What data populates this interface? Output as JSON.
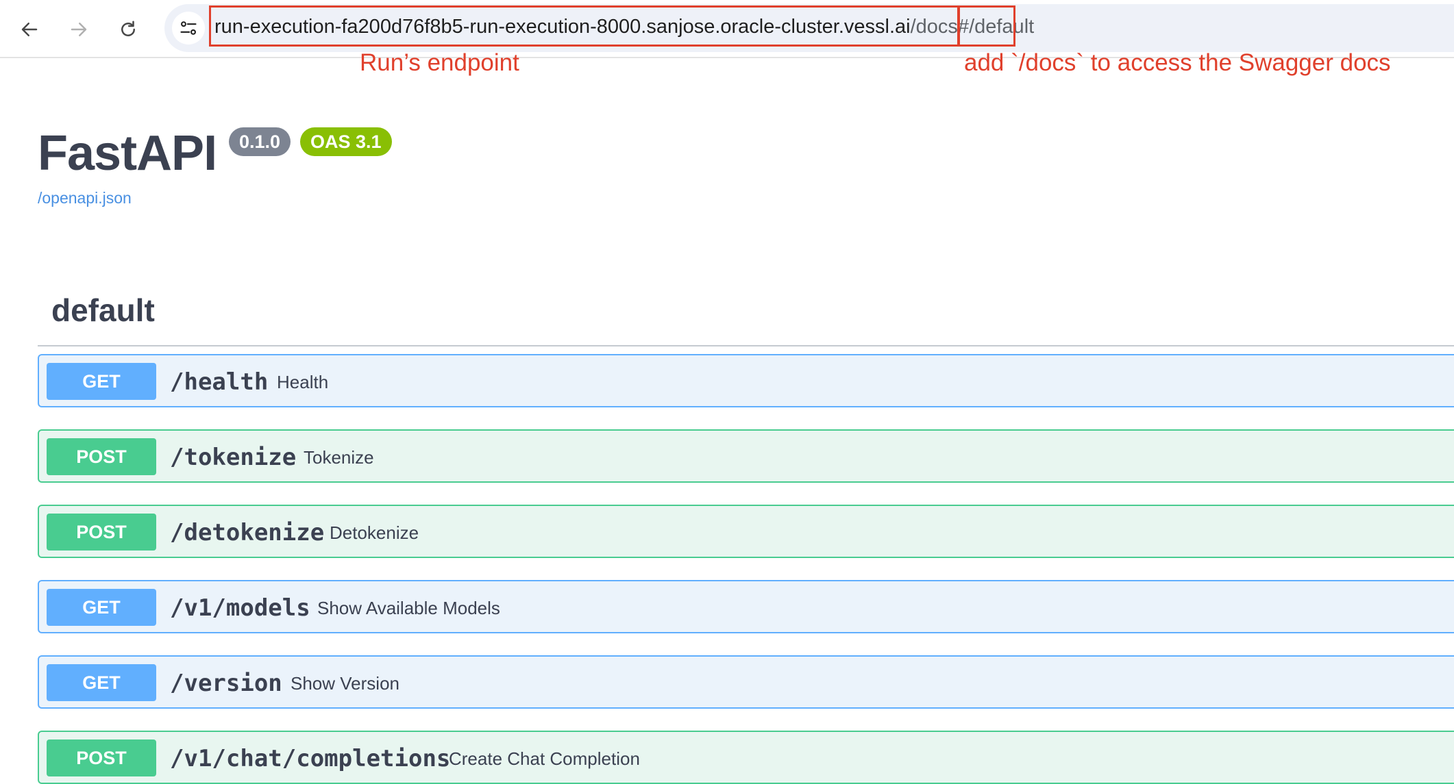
{
  "browser": {
    "url_host": "run-execution-fa200d76f8b5-run-execution-8000.sanjose.oracle-cluster.vessl.ai",
    "url_slash": "/",
    "url_docs": "docs#",
    "url_rest": "/default"
  },
  "annotations": {
    "endpoint_label": "Run’s endpoint",
    "docs_label": "add `/docs` to access the Swagger docs",
    "color": "#e0402c"
  },
  "info": {
    "title": "FastAPI",
    "version": "0.1.0",
    "oas": "OAS 3.1",
    "spec_link": "/openapi.json"
  },
  "section": {
    "title": "default"
  },
  "operations": [
    {
      "method": "GET",
      "path": "/health",
      "summary": "Health"
    },
    {
      "method": "POST",
      "path": "/tokenize",
      "summary": "Tokenize"
    },
    {
      "method": "POST",
      "path": "/detokenize",
      "summary": "Detokenize"
    },
    {
      "method": "GET",
      "path": "/v1/models",
      "summary": "Show Available Models"
    },
    {
      "method": "GET",
      "path": "/version",
      "summary": "Show Version"
    },
    {
      "method": "POST",
      "path": "/v1/chat/completions",
      "summary": "Create Chat Completion"
    }
  ],
  "colors": {
    "get": "#61affe",
    "post": "#49cc90",
    "oas_badge": "#89bf04",
    "version_badge": "#7d8492"
  },
  "icons": [
    "back-arrow-icon",
    "forward-arrow-icon",
    "reload-icon",
    "site-settings-icon"
  ]
}
